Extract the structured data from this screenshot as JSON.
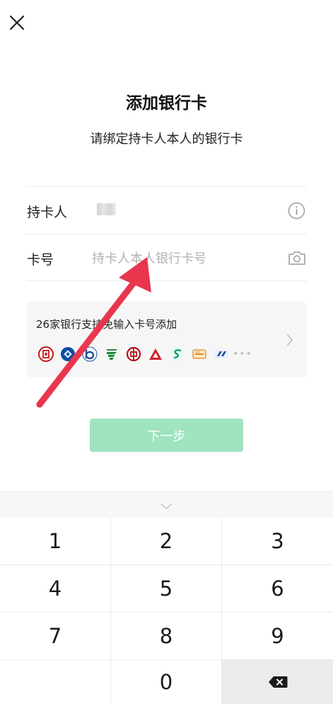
{
  "header": {
    "title": "添加银行卡",
    "subtitle": "请绑定持卡人本人的银行卡"
  },
  "form": {
    "holder_label": "持卡人",
    "card_label": "卡号",
    "card_placeholder": "持卡人本人银行卡号"
  },
  "bank_support": {
    "text": "26家银行支持免输入卡号添加",
    "more": "•••"
  },
  "next_button": "下一步",
  "keypad": {
    "keys": [
      "1",
      "2",
      "3",
      "4",
      "5",
      "6",
      "7",
      "8",
      "9",
      "",
      "0",
      ""
    ]
  },
  "colors": {
    "accent_disabled": "#9fe3bf",
    "annotation_arrow": "#e8364f"
  }
}
